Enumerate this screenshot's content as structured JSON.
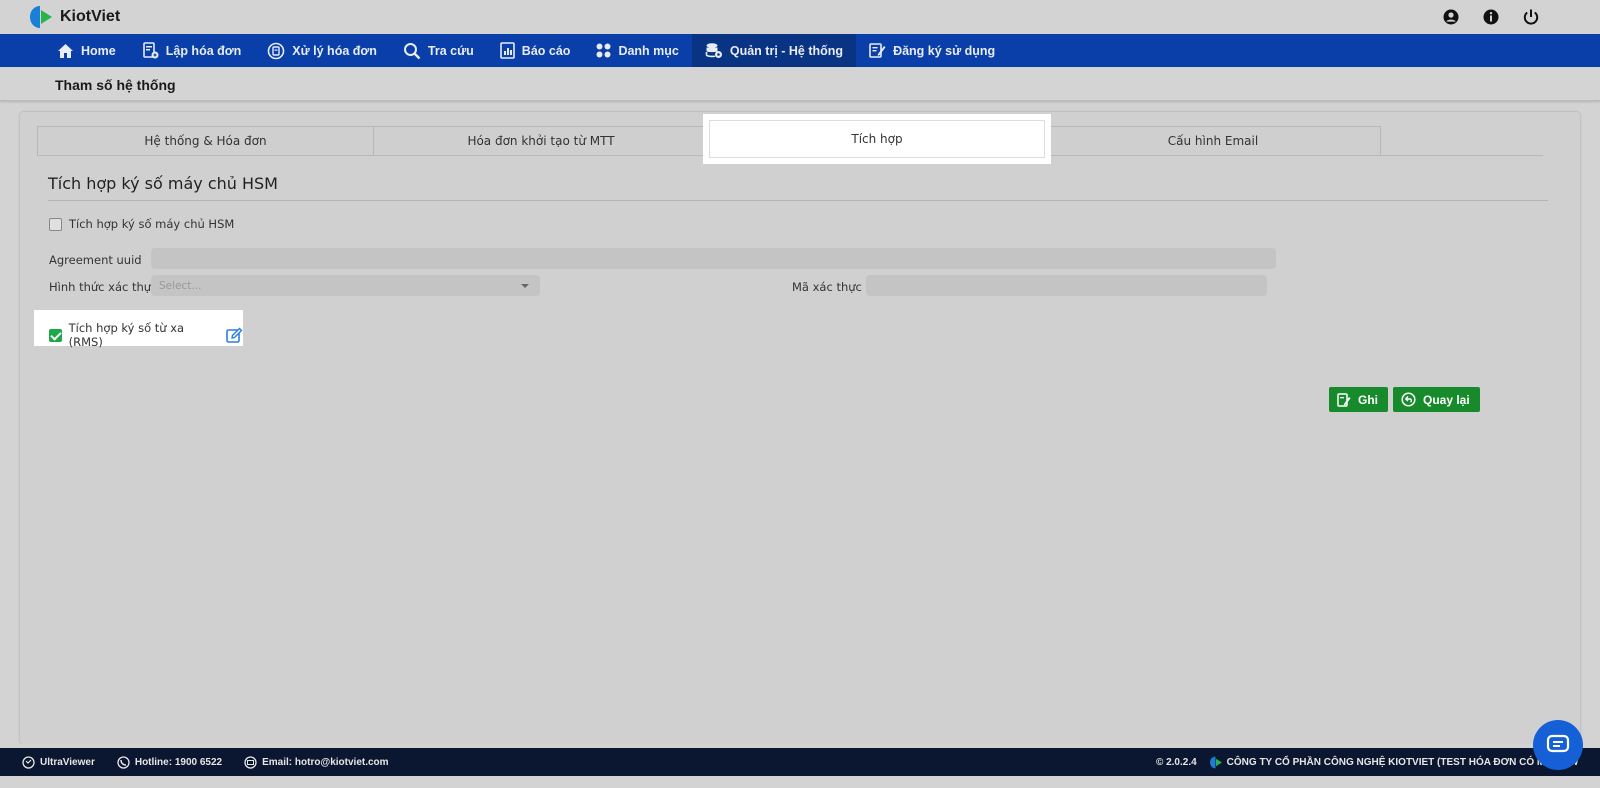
{
  "app": {
    "name": "KiotViet"
  },
  "nav": {
    "items": [
      {
        "label": "Home",
        "icon": "home-icon"
      },
      {
        "label": "Lập hóa đơn",
        "icon": "invoice-create-icon"
      },
      {
        "label": "Xử lý hóa đơn",
        "icon": "invoice-process-icon"
      },
      {
        "label": "Tra cứu",
        "icon": "search-icon"
      },
      {
        "label": "Báo cáo",
        "icon": "report-icon"
      },
      {
        "label": "Danh mục",
        "icon": "category-icon"
      },
      {
        "label": "Quản trị - Hệ thống",
        "icon": "admin-icon",
        "active": true
      },
      {
        "label": "Đăng ký sử dụng",
        "icon": "register-icon"
      }
    ]
  },
  "page": {
    "title": "Tham số hệ thống"
  },
  "tabs": [
    {
      "label": "Hệ thống & Hóa đơn"
    },
    {
      "label": "Hóa đơn khởi tạo từ MTT"
    },
    {
      "label": "Tích hợp",
      "active": true
    },
    {
      "label": "Cấu hình Email"
    }
  ],
  "section": {
    "title": "Tích hợp ký số máy chủ HSM",
    "hsm_checkbox_label": "Tích hợp ký số máy chủ HSM",
    "hsm_checked": false,
    "agreement_label": "Agreement uuid",
    "agreement_value": "",
    "auth_method_label": "Hình thức xác thực",
    "auth_method_placeholder": "Select...",
    "auth_code_label": "Mã xác thực",
    "auth_code_value": "",
    "rms_checkbox_label": "Tích hợp ký số từ xa (RMS)",
    "rms_checked": true
  },
  "buttons": {
    "save": "Ghi",
    "back": "Quay lại"
  },
  "footer": {
    "ultraviewer": "UltraViewer",
    "hotline": "Hotline: 1900 6522",
    "email": "Email: hotro@kiotviet.com",
    "version": "© 2.0.2.4",
    "company": "CÔNG TY CỔ PHẦN CÔNG NGHỆ KIOTVIET (TEST HÓA ĐƠN CÓ MÃ) new"
  },
  "colors": {
    "nav_bg": "#0a3ea8",
    "nav_active": "#093383",
    "accent_green": "#178a2b",
    "footer_bg": "#0b1730"
  }
}
